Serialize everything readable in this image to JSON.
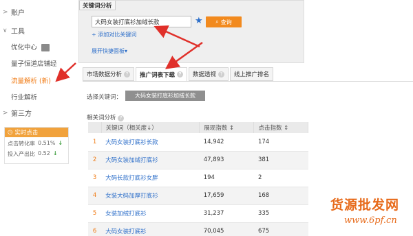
{
  "sidebar": {
    "sections": [
      {
        "label": "账户",
        "arrow": ">"
      },
      {
        "label": "工具",
        "arrow": "∨"
      },
      {
        "label": "第三方",
        "arrow": ">"
      }
    ],
    "items": [
      {
        "label": "优化中心"
      },
      {
        "label": "量子恒道店铺经"
      },
      {
        "label": "流量解析 (新)"
      },
      {
        "label": "行业解析"
      }
    ],
    "realtime": {
      "title": "实时点击",
      "rows": [
        {
          "label": "点击转化率",
          "value": "0.51%"
        },
        {
          "label": "投入产出比",
          "value": "0.52"
        }
      ]
    }
  },
  "keyword_panel": {
    "title": "关键词分析",
    "input_value": "大码女装打底衫加绒长款",
    "search_label": "查询",
    "add_compare_label": "添加对比关键词",
    "expand_label": "展开快捷面板"
  },
  "tabs": [
    {
      "label": "市场数据分析"
    },
    {
      "label": "推广词表下载"
    },
    {
      "label": "数据透视"
    },
    {
      "label": "线上推广排名"
    }
  ],
  "selection": {
    "label": "选择关键词：",
    "chip": "大码女装打底衫加绒长款"
  },
  "related": {
    "title": "相关词分析"
  },
  "table": {
    "headers": [
      "关键词（相关度↓）",
      "展现指数 ↕",
      "点击指数 ↕"
    ],
    "rows": [
      {
        "idx": "1",
        "keyword": "大码女装打底衫长款",
        "impressions": "14,942",
        "clicks": "174"
      },
      {
        "idx": "2",
        "keyword": "大码女装加绒打底衫",
        "impressions": "47,893",
        "clicks": "381"
      },
      {
        "idx": "3",
        "keyword": "大码长款打底衫女胖",
        "impressions": "194",
        "clicks": "2"
      },
      {
        "idx": "4",
        "keyword": "女装大码加厚打底衫",
        "impressions": "17,659",
        "clicks": "168"
      },
      {
        "idx": "5",
        "keyword": "女装加绒打底衫",
        "impressions": "31,237",
        "clicks": "335"
      },
      {
        "idx": "6",
        "keyword": "大码女装打底衫",
        "impressions": "70,045",
        "clicks": "675"
      }
    ]
  },
  "watermark": {
    "cn": "货源批发网",
    "url": "www.6pf.cn"
  },
  "colors": {
    "accent": "#f07a13",
    "link": "#2c6ec9",
    "annotation": "#e0302a"
  }
}
